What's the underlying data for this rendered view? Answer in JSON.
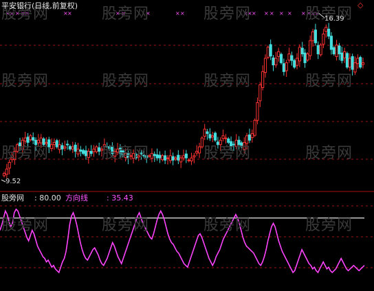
{
  "window": {
    "title": "平安银行(日线,前复权)",
    "diamond_icon": "diamond-icon"
  },
  "watermark": "股旁网",
  "price_panel": {
    "high_label": "16.39",
    "low_label": "9.52",
    "colors": {
      "up": "#ff3333",
      "down": "#44dddd",
      "grid": "#a01010",
      "marker": "#ff55ff"
    }
  },
  "indicator_panel": {
    "name": "股旁网",
    "level_value": ": 80.00",
    "series_name": "方向线",
    "series_value": ": 35.43",
    "colors": {
      "line": "#ff44ff",
      "level": "#cccccc"
    }
  },
  "chart_data": [
    {
      "type": "candlestick",
      "title": "平安银行(日线,前复权)",
      "ylim": [
        9.0,
        17.0
      ],
      "annotations": [
        "16.39",
        "9.52"
      ],
      "close": [
        9.6,
        9.8,
        10.1,
        10.3,
        10.6,
        10.9,
        10.8,
        11.1,
        11.2,
        11.0,
        11.3,
        11.1,
        10.9,
        11.1,
        11.2,
        10.9,
        11.0,
        10.8,
        10.9,
        11.0,
        10.8,
        10.9,
        10.7,
        10.8,
        10.9,
        10.7,
        10.8,
        10.6,
        10.7,
        10.6,
        10.5,
        10.4,
        10.6,
        10.5,
        10.7,
        10.8,
        10.6,
        10.7,
        10.9,
        10.8,
        10.7,
        10.5,
        10.6,
        10.7,
        10.5,
        10.4,
        10.5,
        10.3,
        10.4,
        10.5,
        10.3,
        10.4,
        10.5,
        10.4,
        10.3,
        10.4,
        10.5,
        10.4,
        10.3,
        10.3,
        10.4,
        10.2,
        10.3,
        10.4,
        10.2,
        10.3,
        10.2,
        10.3,
        10.4,
        10.3,
        10.2,
        10.3,
        10.4,
        10.6,
        10.8,
        11.2,
        11.6,
        11.4,
        11.2,
        11.3,
        11.1,
        10.9,
        11.1,
        11.3,
        11.2,
        11.0,
        10.8,
        10.9,
        11.1,
        10.9,
        10.8,
        11.0,
        11.3,
        11.1,
        11.4,
        12.0,
        12.8,
        13.6,
        14.2,
        14.8,
        15.3,
        14.9,
        14.5,
        14.8,
        15.1,
        14.6,
        14.2,
        14.6,
        15.0,
        14.7,
        14.4,
        14.8,
        15.3,
        15.0,
        14.6,
        15.0,
        15.6,
        16.0,
        15.5,
        15.0,
        15.4,
        15.9,
        16.2,
        15.8,
        15.2,
        15.0,
        15.4,
        15.0,
        14.7,
        15.1,
        14.4,
        14.8,
        14.3,
        14.6,
        14.8,
        14.4,
        14.6
      ],
      "markers_top": true
    },
    {
      "type": "line",
      "title": "",
      "series": [
        {
          "name": "方向线",
          "values": [
            66,
            72,
            80,
            88,
            84,
            76,
            70,
            74,
            86,
            90,
            88,
            82,
            76,
            70,
            64,
            58,
            54,
            60,
            66,
            62,
            55,
            48,
            44,
            40,
            36,
            34,
            30,
            32,
            28,
            24,
            26,
            22,
            20,
            18,
            24,
            30,
            34,
            42,
            56,
            72,
            82,
            86,
            80,
            72,
            62,
            52,
            44,
            38,
            34,
            32,
            36,
            40,
            44,
            46,
            42,
            38,
            32,
            28,
            26,
            30,
            34,
            40,
            46,
            52,
            48,
            42,
            36,
            32,
            28,
            34,
            40,
            46,
            52,
            58,
            64,
            70,
            76,
            82,
            86,
            80,
            74,
            70,
            66,
            62,
            58,
            56,
            62,
            70,
            78,
            84,
            88,
            84,
            78,
            70,
            62,
            56,
            52,
            50,
            46,
            42,
            40,
            36,
            32,
            28,
            26,
            24,
            30,
            36,
            42,
            48,
            54,
            60,
            62,
            58,
            52,
            46,
            40,
            34,
            30,
            26,
            30,
            36,
            40,
            44,
            50,
            56,
            60,
            64,
            68,
            72,
            76,
            80,
            84,
            80,
            74,
            66,
            58,
            52,
            48,
            46,
            44,
            42,
            40,
            36,
            32,
            28,
            26,
            30,
            36,
            44,
            54,
            62,
            70,
            74,
            70,
            62,
            54,
            48,
            42,
            38,
            34,
            30,
            26,
            22,
            18,
            20,
            26,
            32,
            38,
            44,
            40,
            36,
            32,
            28,
            26,
            22,
            24,
            20,
            18,
            22,
            26,
            30,
            26,
            22,
            24,
            20,
            18,
            20,
            22,
            26,
            30,
            34,
            30,
            26,
            22,
            20,
            22,
            24,
            26,
            24,
            22,
            20,
            22,
            24,
            26
          ]
        }
      ],
      "level": 80.0,
      "last_value": 35.43,
      "ylim": [
        0,
        100
      ]
    }
  ]
}
